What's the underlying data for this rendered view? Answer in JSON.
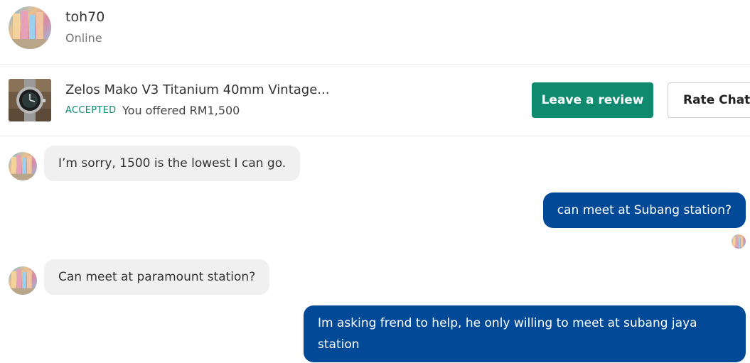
{
  "header": {
    "user_name": "toh70",
    "user_status": "Online",
    "avatar_icon": "user-avatar-icon"
  },
  "listing": {
    "title": "Zelos Mako V3 Titanium 40mm Vintage...",
    "status": "ACCEPTED",
    "offer_text": "You offered RM1,500",
    "review_button": "Leave a review",
    "rate_button": "Rate Chat",
    "accent_color": "#108a6e"
  },
  "messages": [
    {
      "sender": "other",
      "text": "I’m sorry, 1500 is the lowest I can go."
    },
    {
      "sender": "me",
      "text": "can meet at Subang station?"
    },
    {
      "sender": "other",
      "text": "Can meet at paramount station?"
    },
    {
      "sender": "me",
      "text": "Im asking frend to help, he only willing to meet at subang jaya station"
    }
  ],
  "colors": {
    "outgoing_bubble": "#024a97",
    "incoming_bubble": "#f0f0f0"
  }
}
